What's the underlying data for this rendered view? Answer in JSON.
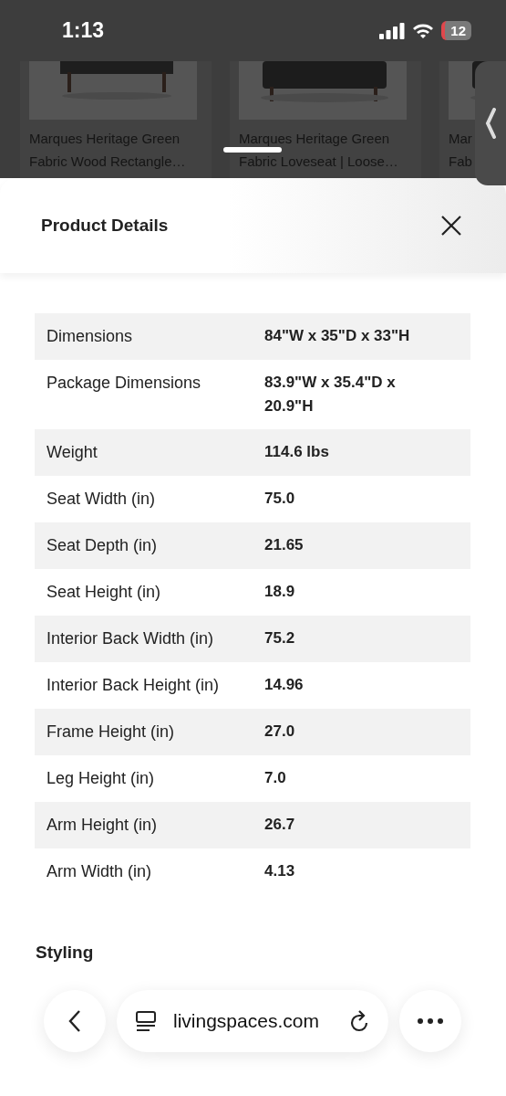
{
  "status_bar": {
    "time": "1:13",
    "battery": "12"
  },
  "background_cards": [
    {
      "title_line_1": "Marques Heritage Green",
      "title_line_2": "Fabric Wood Rectangle…"
    },
    {
      "title_line_1": "Marques Heritage Green",
      "title_line_2": "Fabric Loveseat | Loose…"
    },
    {
      "title_line_1": "Mar",
      "title_line_2": "Fab"
    }
  ],
  "sheet": {
    "title": "Product Details"
  },
  "details": [
    {
      "label": "Dimensions",
      "value": "84\"W x 35\"D x 33\"H"
    },
    {
      "label": "Package Dimensions",
      "value": "83.9\"W x 35.4\"D x 20.9\"H"
    },
    {
      "label": "Weight",
      "value": "114.6 lbs"
    },
    {
      "label": "Seat Width (in)",
      "value": "75.0"
    },
    {
      "label": "Seat Depth (in)",
      "value": "21.65"
    },
    {
      "label": "Seat Height (in)",
      "value": "18.9"
    },
    {
      "label": "Interior Back Width (in)",
      "value": "75.2"
    },
    {
      "label": "Interior Back Height (in)",
      "value": "14.96"
    },
    {
      "label": "Frame Height (in)",
      "value": "27.0"
    },
    {
      "label": "Leg Height (in)",
      "value": "7.0"
    },
    {
      "label": "Arm Height (in)",
      "value": "26.7"
    },
    {
      "label": "Arm Width (in)",
      "value": "4.13"
    }
  ],
  "section_heading": "Styling",
  "browser_bar": {
    "url": "livingspaces.com"
  }
}
